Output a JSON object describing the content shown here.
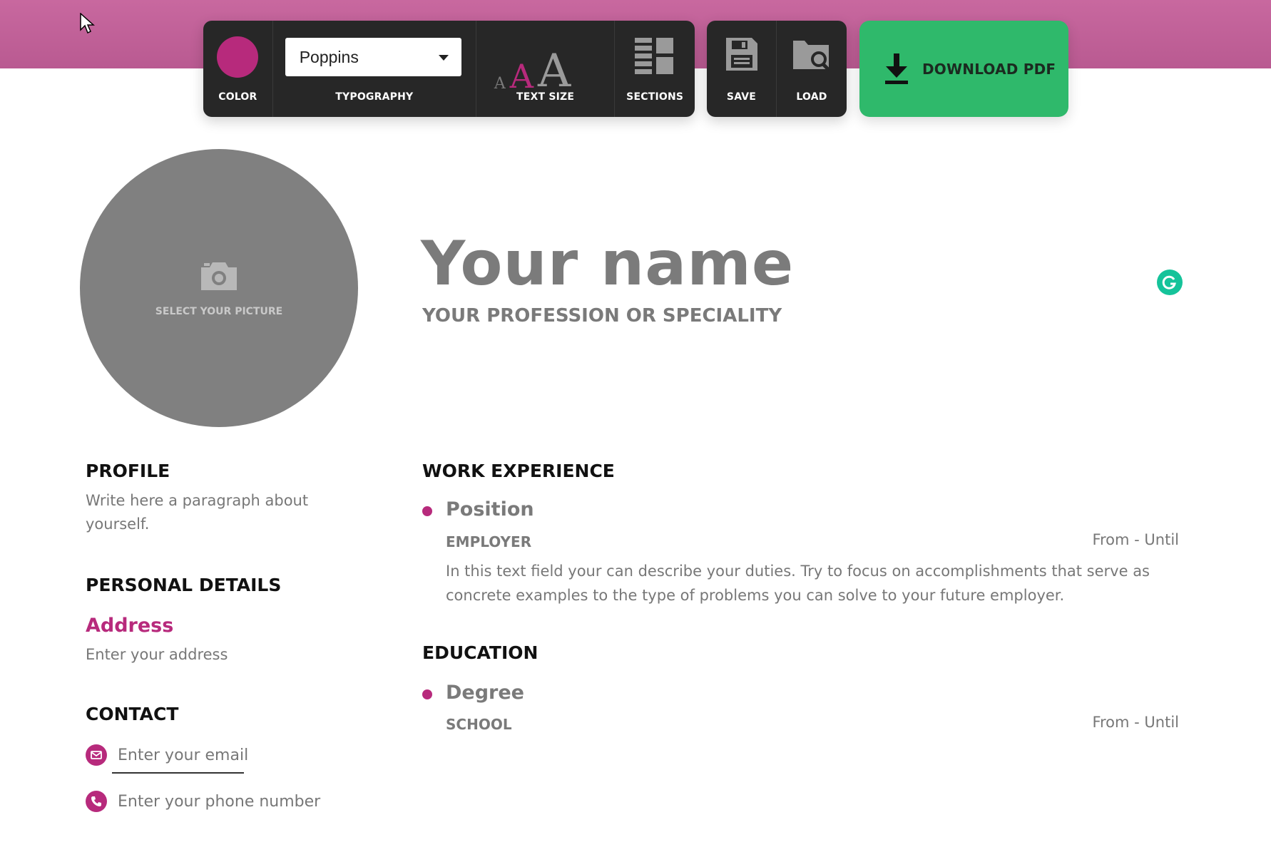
{
  "toolbar": {
    "color_label": "COLOR",
    "accent_color": "#b72a7c",
    "typography_label": "TYPOGRAPHY",
    "font_value": "Poppins",
    "text_size_label": "TEXT SIZE",
    "text_size_glyph": "A",
    "sections_label": "SECTIONS",
    "save_label": "SAVE",
    "load_label": "LOAD",
    "download_label": "DOWNLOAD PDF",
    "download_color": "#2fb96b"
  },
  "header_band_color": "#c8689f",
  "photo": {
    "caption": "SELECT YOUR PICTURE",
    "icon": "camera-icon"
  },
  "resume": {
    "name": "Your name",
    "profession": "YOUR PROFESSION OR SPECIALITY"
  },
  "sidebar": {
    "profile_title": "PROFILE",
    "profile_text": "Write here a paragraph about yourself.",
    "personal_title": "PERSONAL DETAILS",
    "address_label": "Address",
    "address_placeholder": "Enter your address",
    "contact_title": "CONTACT",
    "email_placeholder": "Enter your email",
    "phone_placeholder": "Enter your phone number"
  },
  "work": {
    "title": "WORK EXPERIENCE",
    "position": "Position",
    "employer": "EMPLOYER",
    "dates": "From - Until",
    "description": "In this text field your can describe your duties. Try to focus on accomplishments that serve as concrete examples to the type of problems you can solve to your future employer."
  },
  "education": {
    "title": "EDUCATION",
    "degree": "Degree",
    "school": "SCHOOL",
    "dates": "From - Until"
  }
}
